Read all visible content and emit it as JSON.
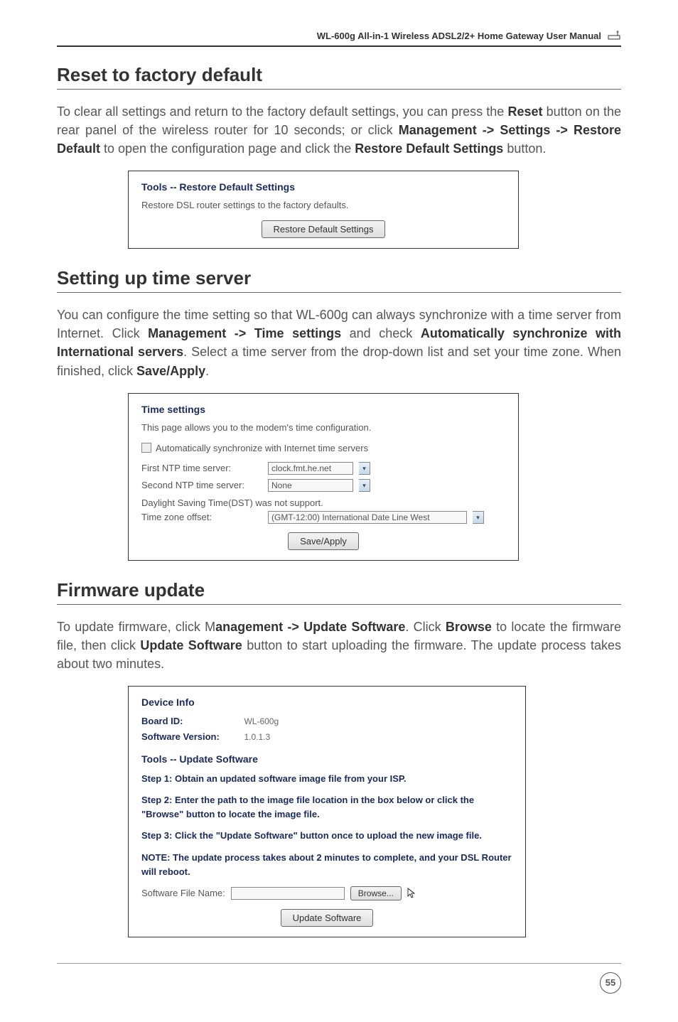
{
  "header": {
    "title": "WL-600g All-in-1 Wireless ADSL2/2+ Home Gateway User Manual"
  },
  "section1": {
    "heading": "Reset to factory default",
    "paragraph_pre": "To clear all settings and return to the factory default settings, you can press the ",
    "reset": "Reset",
    "p2": " button on the rear panel of the wireless router for 10 seconds; or click ",
    "mgmt": "Management -> Settings -> Restore Default",
    "p3": " to open the configuration page and click the ",
    "restore": "Restore Default Settings",
    "p4": " button.",
    "ss": {
      "title": "Tools -- Restore Default Settings",
      "desc": "Restore DSL router settings to the factory defaults.",
      "button": "Restore Default Settings"
    }
  },
  "section2": {
    "heading": "Setting up time server",
    "p1": "You can configure the time setting so that WL-600g can always synchronize with a time server from Internet. Click ",
    "b1": "Management -> Time settings",
    "p2": " and check ",
    "b2": "Automatically synchronize with International servers",
    "p3": ". Select a time server from the drop-down list and set your time zone. When finished, click ",
    "b3": "Save/Apply",
    "p4": ".",
    "ss": {
      "title": "Time settings",
      "desc": "This page allows you to the modem's time configuration.",
      "chk_label": "Automatically synchronize with Internet time servers",
      "field1": "First NTP time server:",
      "val1": "clock.fmt.he.net",
      "field2": "Second NTP time server:",
      "val2": "None",
      "field3": "Daylight Saving Time(DST) was not support.",
      "field4": "Time zone offset:",
      "val4": "(GMT-12:00) International Date Line West",
      "button": "Save/Apply"
    }
  },
  "section3": {
    "heading": "Firmware update",
    "p1": "To update firmware, click M",
    "b1": "anagement -> Update Software",
    "p2": ". Click ",
    "b2": "Browse",
    "p3": " to locate the firmware file, then click ",
    "b3": "Update Software",
    "p4": " button to start uploading the firmware. The update process takes about two minutes.",
    "ss": {
      "title1": "Device Info",
      "board_label": "Board ID:",
      "board_val": "WL-600g",
      "ver_label": "Software Version:",
      "ver_val": "1.0.1.3",
      "title2": "Tools -- Update Software",
      "step1": "Step 1: Obtain an updated software image file from your ISP.",
      "step2": "Step 2: Enter the path to the image file location in the box below or click the \"Browse\" button to locate the image file.",
      "step3": "Step 3: Click the \"Update Software\" button once to upload the new image file.",
      "note": "NOTE: The update process takes about 2 minutes to complete, and your DSL Router will reboot.",
      "file_label": "Software File Name:",
      "browse": "Browse...",
      "button": "Update Software"
    }
  },
  "page_number": "55"
}
